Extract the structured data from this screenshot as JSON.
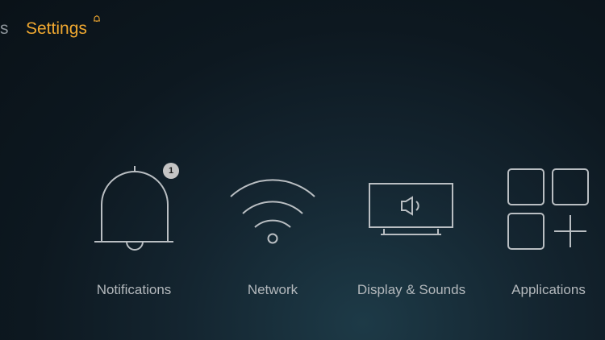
{
  "nav": {
    "previous_label": "s",
    "current_label": "Settings",
    "bell_icon": "bell-icon"
  },
  "tiles": [
    {
      "label": "Notifications",
      "icon": "bell-icon",
      "badge": "1"
    },
    {
      "label": "Network",
      "icon": "wifi-icon"
    },
    {
      "label": "Display & Sounds",
      "icon": "tv-speaker-icon"
    },
    {
      "label": "Applications",
      "icon": "apps-grid-icon"
    }
  ],
  "colors": {
    "accent": "#f0a830",
    "label": "#b3b8bc",
    "icon_stroke": "#b9bec2",
    "badge": "#c4c4c4"
  }
}
